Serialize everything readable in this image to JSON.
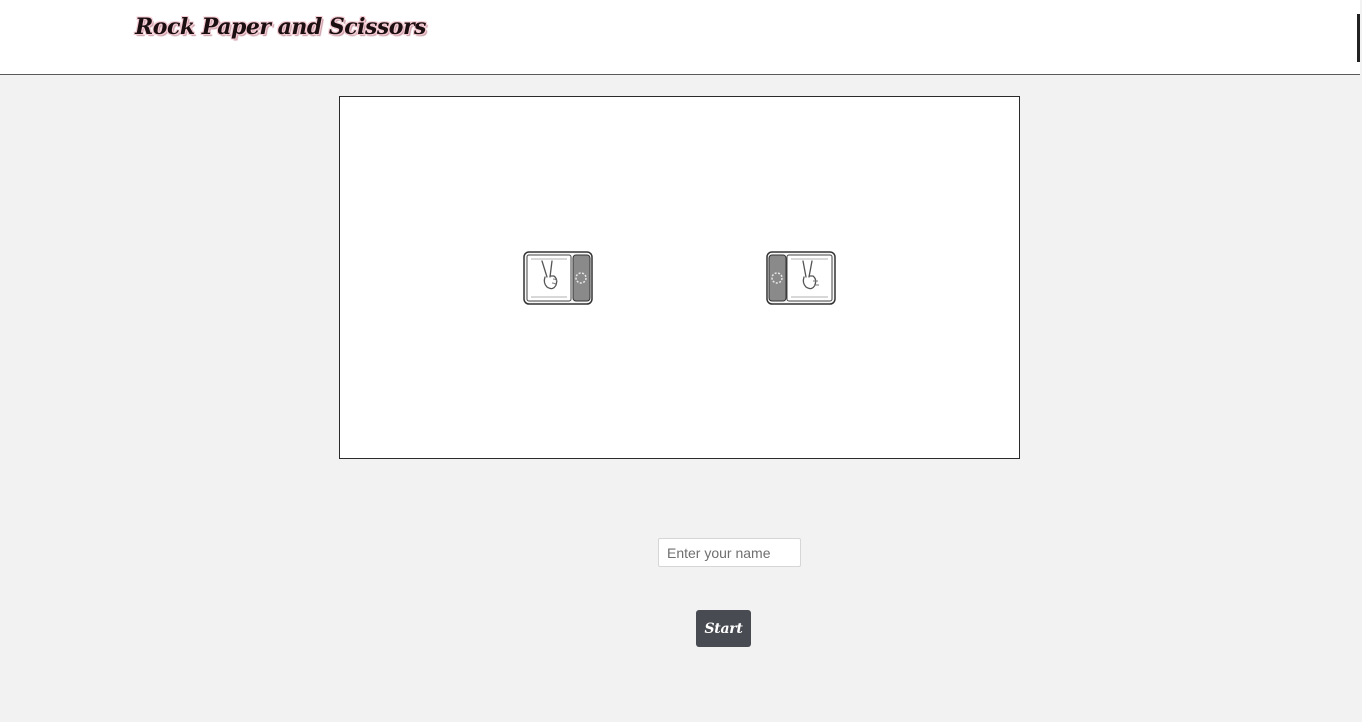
{
  "header": {
    "title": "Rock Paper and Scissors"
  },
  "game": {
    "player_die_icon": "scissors-hand-icon",
    "opponent_die_icon": "scissors-hand-icon"
  },
  "form": {
    "name_placeholder": "Enter your name",
    "name_value": "",
    "start_label": "Start"
  },
  "colors": {
    "page_background": "#f2f2f2",
    "button_background": "#484b52",
    "title_outline": "#f4c9d2"
  }
}
